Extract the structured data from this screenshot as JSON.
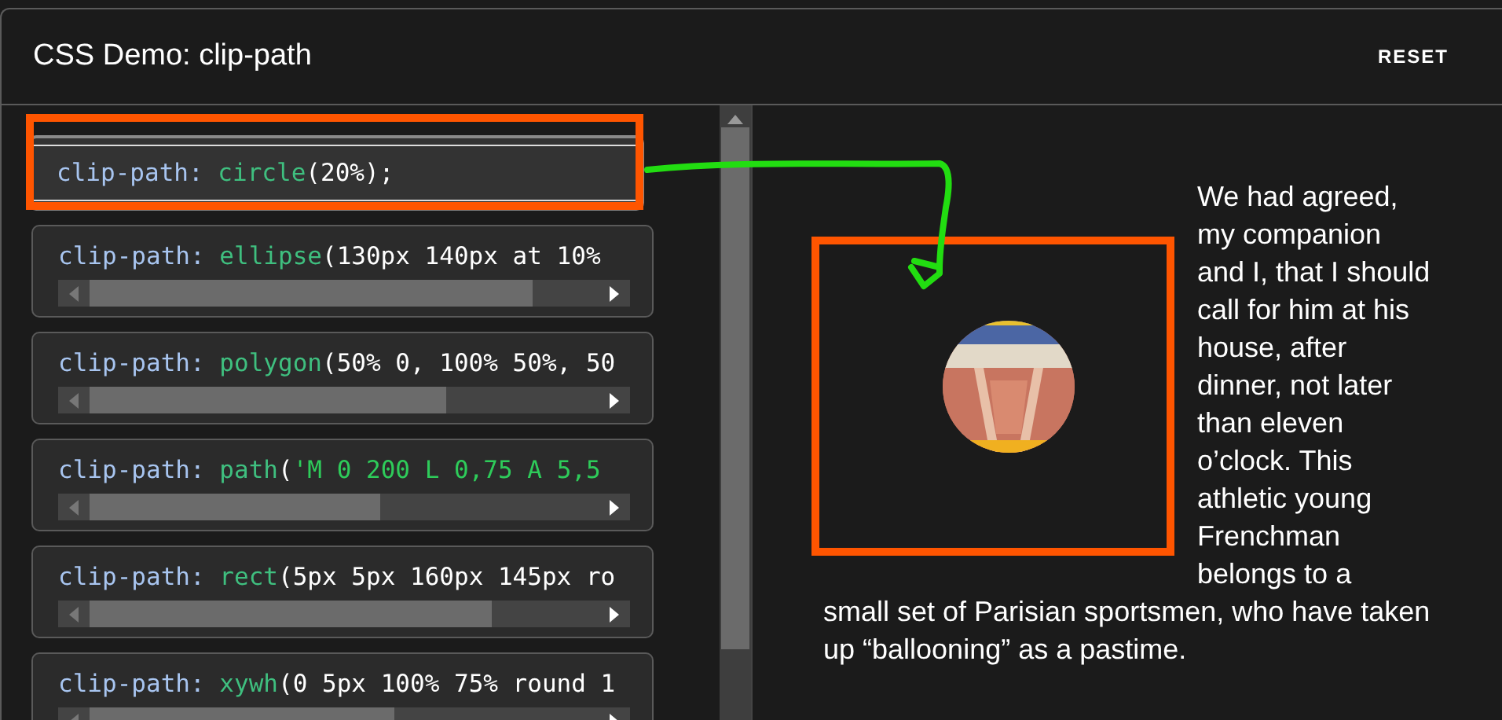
{
  "header": {
    "title": "CSS Demo: clip-path",
    "reset": "RESET"
  },
  "options": [
    {
      "selected": true,
      "tokens": [
        {
          "kind": "property",
          "text": "clip-path:"
        },
        {
          "kind": "function",
          "text": " circle"
        },
        {
          "kind": "plain",
          "text": "(20%);"
        }
      ]
    },
    {
      "selected": false,
      "tokens": [
        {
          "kind": "property",
          "text": "clip-path:"
        },
        {
          "kind": "function",
          "text": " ellipse"
        },
        {
          "kind": "plain",
          "text": "(130px 140px at 10%"
        }
      ]
    },
    {
      "selected": false,
      "tokens": [
        {
          "kind": "property",
          "text": "clip-path:"
        },
        {
          "kind": "function",
          "text": " polygon"
        },
        {
          "kind": "plain",
          "text": "(50% 0, 100% 50%, 50"
        }
      ]
    },
    {
      "selected": false,
      "tokens": [
        {
          "kind": "property",
          "text": "clip-path:"
        },
        {
          "kind": "function",
          "text": " path"
        },
        {
          "kind": "plain",
          "text": "("
        },
        {
          "kind": "string",
          "text": "'M 0 200 L 0,75 A 5,5"
        }
      ]
    },
    {
      "selected": false,
      "tokens": [
        {
          "kind": "property",
          "text": "clip-path:"
        },
        {
          "kind": "function",
          "text": " rect"
        },
        {
          "kind": "plain",
          "text": "(5px 5px 160px 145px ro"
        }
      ]
    },
    {
      "selected": false,
      "tokens": [
        {
          "kind": "property",
          "text": "clip-path:"
        },
        {
          "kind": "function",
          "text": " xywh"
        },
        {
          "kind": "plain",
          "text": "(0 5px 100% 75% round 1"
        }
      ]
    }
  ],
  "output": {
    "text_beside": "We had agreed, my companion and I, that I should call for him at his house, after dinner, not later than eleven o’clock. This athletic young Frenchman belongs to a",
    "text_below": "small set of Parisian sportsmen, who have taken up “ballooning” as a pastime."
  }
}
